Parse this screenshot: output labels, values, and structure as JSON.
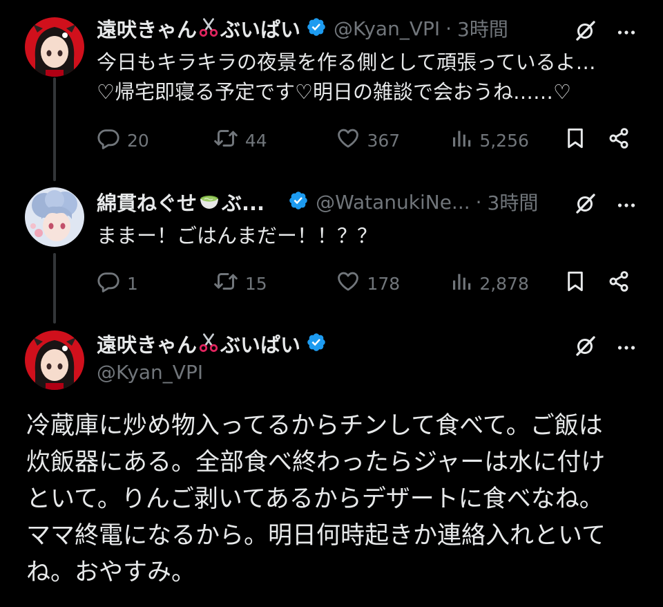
{
  "theme": {
    "background": "#000000",
    "text": "#e7e9ea",
    "muted": "#71767b",
    "verified": "#1d9bf0",
    "thread_line": "#333639"
  },
  "tweets": [
    {
      "display_name": "遠吠きゃん",
      "name_emoji": "scissors",
      "name_suffix": "ぶいぱい",
      "handle": "@Kyan_VPI",
      "dot": "·",
      "time": "3時間",
      "text": "今日もキラキラの夜景を作る側として頑張っているよ…\n♡帰宅即寝る予定です♡明日の雑談で会おうね……♡",
      "replies": "20",
      "retweets": "44",
      "likes": "367",
      "views": "5,256"
    },
    {
      "display_name": "綿貫ねぐせ",
      "name_emoji": "matcha",
      "name_suffix": "ぶ...",
      "handle": "@WatanukiNe...",
      "dot": "·",
      "time": "3時間",
      "text": "ままー！ごはんまだー！！？？",
      "replies": "1",
      "retweets": "15",
      "likes": "178",
      "views": "2,878"
    }
  ],
  "main_tweet": {
    "display_name": "遠吠きゃん",
    "name_emoji": "scissors",
    "name_suffix": "ぶいぱい",
    "handle": "@Kyan_VPI",
    "text": "冷蔵庫に炒め物入ってるからチンして食べて。ご飯は\n炊飯器にある。全部食べ終わったらジャーは水に付け\nといて。りんご剥いてあるからデザートに食べなね。\nママ終電になるから。明日何時起きか連絡入れといて\nね。おやすみ。"
  },
  "icons": {
    "grok": "grok-icon",
    "more": "more-icon",
    "reply": "reply-icon",
    "retweet": "retweet-icon",
    "like": "like-icon",
    "views": "views-icon",
    "bookmark": "bookmark-icon",
    "share": "share-icon"
  }
}
